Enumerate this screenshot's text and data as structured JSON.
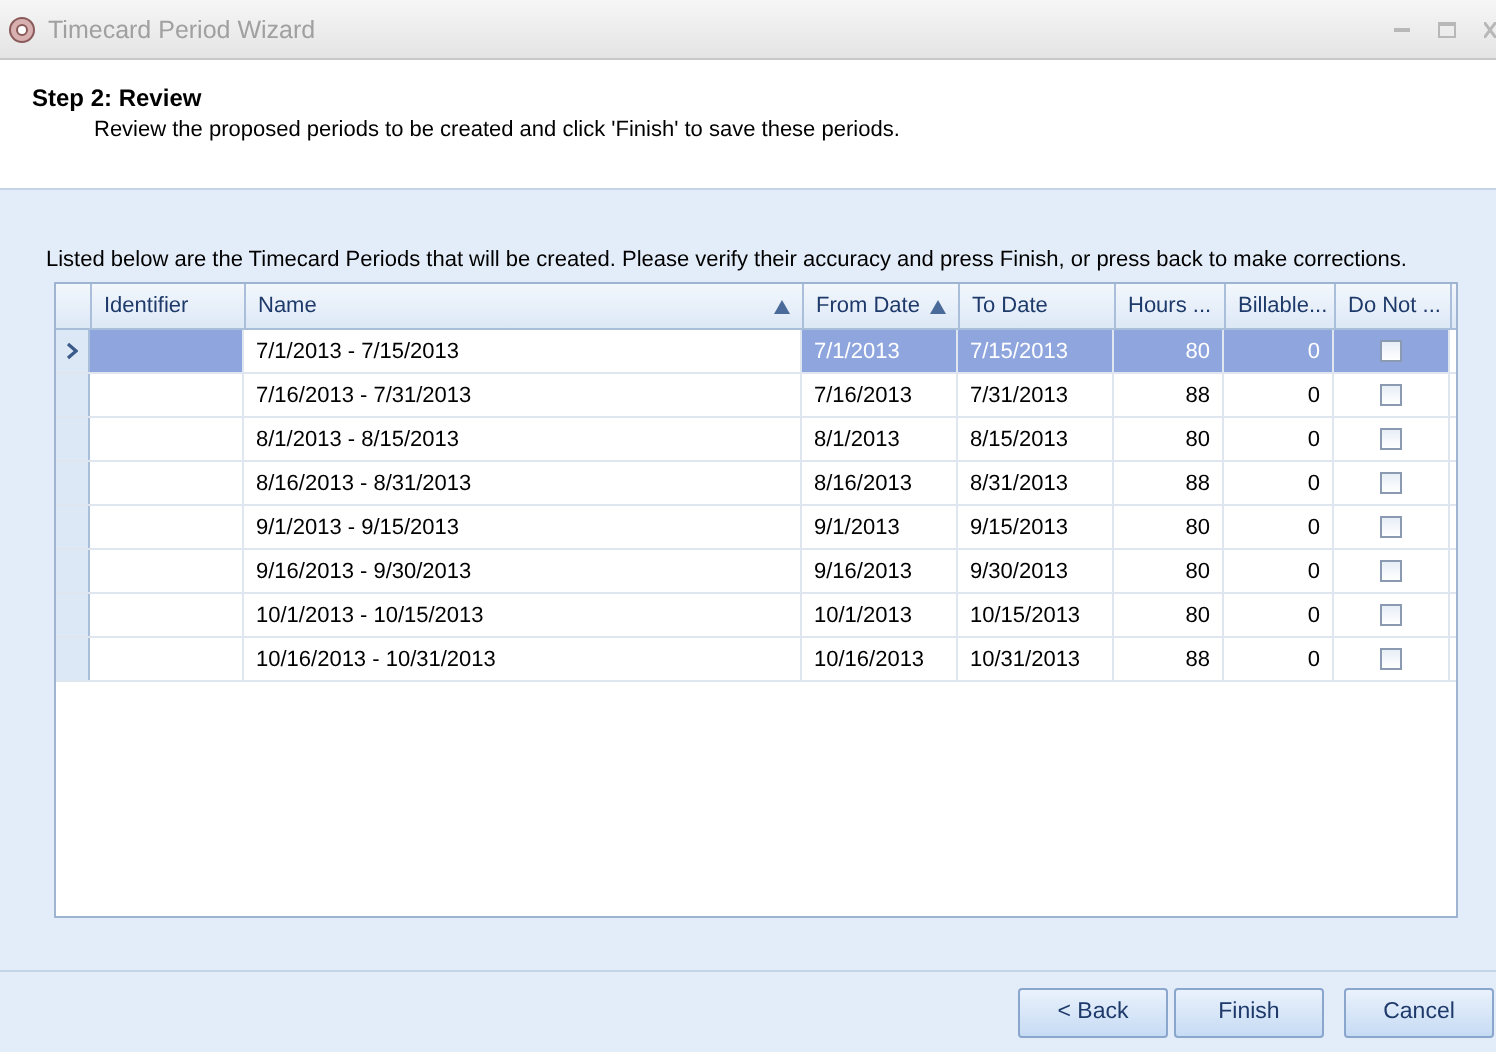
{
  "window": {
    "title": "Timecard Period Wizard"
  },
  "header": {
    "title": "Step 2: Review",
    "subtitle": "Review the proposed periods to be created and click 'Finish' to save these periods."
  },
  "instructions": "Listed below are the Timecard Periods that will be created.  Please verify their accuracy and press Finish, or press back to make corrections.",
  "table": {
    "columns": [
      {
        "label": "Identifier",
        "sorted": false,
        "kind": "text"
      },
      {
        "label": "Name",
        "sorted": true,
        "kind": "text"
      },
      {
        "label": "From Date",
        "sorted": true,
        "kind": "text"
      },
      {
        "label": "To Date",
        "sorted": false,
        "kind": "text"
      },
      {
        "label": "Hours ...",
        "sorted": false,
        "kind": "number"
      },
      {
        "label": "Billable...",
        "sorted": false,
        "kind": "number"
      },
      {
        "label": "Do Not ...",
        "sorted": false,
        "kind": "check"
      }
    ],
    "rows": [
      {
        "selected": true,
        "cells": [
          "",
          "7/1/2013 - 7/15/2013",
          "7/1/2013",
          "7/15/2013",
          "80",
          "0"
        ],
        "checked": false
      },
      {
        "selected": false,
        "cells": [
          "",
          "7/16/2013 - 7/31/2013",
          "7/16/2013",
          "7/31/2013",
          "88",
          "0"
        ],
        "checked": false
      },
      {
        "selected": false,
        "cells": [
          "",
          "8/1/2013 - 8/15/2013",
          "8/1/2013",
          "8/15/2013",
          "80",
          "0"
        ],
        "checked": false
      },
      {
        "selected": false,
        "cells": [
          "",
          "8/16/2013 - 8/31/2013",
          "8/16/2013",
          "8/31/2013",
          "88",
          "0"
        ],
        "checked": false
      },
      {
        "selected": false,
        "cells": [
          "",
          "9/1/2013 - 9/15/2013",
          "9/1/2013",
          "9/15/2013",
          "80",
          "0"
        ],
        "checked": false
      },
      {
        "selected": false,
        "cells": [
          "",
          "9/16/2013 - 9/30/2013",
          "9/16/2013",
          "9/30/2013",
          "80",
          "0"
        ],
        "checked": false
      },
      {
        "selected": false,
        "cells": [
          "",
          "10/1/2013 - 10/15/2013",
          "10/1/2013",
          "10/15/2013",
          "80",
          "0"
        ],
        "checked": false
      },
      {
        "selected": false,
        "cells": [
          "",
          "10/16/2013 - 10/31/2013",
          "10/16/2013",
          "10/31/2013",
          "88",
          "0"
        ],
        "checked": false
      }
    ]
  },
  "buttons": [
    {
      "label": "< Back"
    },
    {
      "label": "Finish"
    },
    {
      "label": "Cancel"
    }
  ]
}
